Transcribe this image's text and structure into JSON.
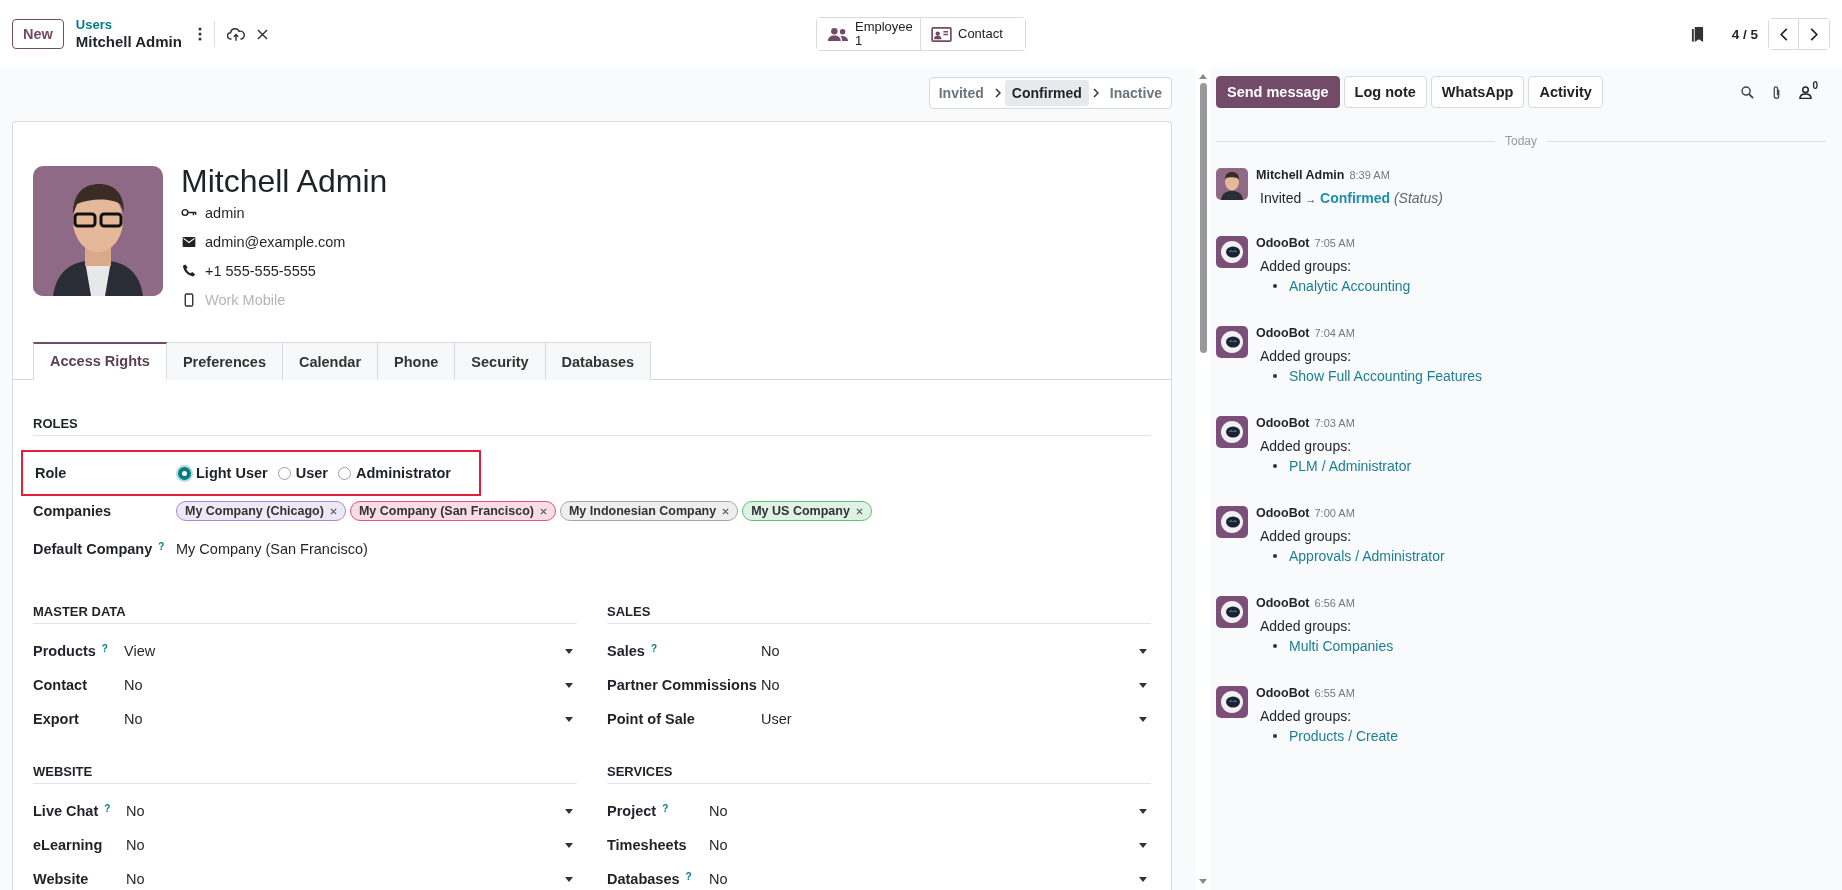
{
  "top_bar": {
    "new_button": "New",
    "breadcrumb": "Users",
    "record": "Mitchell Admin",
    "smart_buttons": [
      {
        "kind": "employee",
        "label": "Employee",
        "count": "1"
      },
      {
        "kind": "contact",
        "label": "Contact"
      }
    ],
    "pager": "4 / 5"
  },
  "statusbar": [
    {
      "label": "Invited",
      "selected": false
    },
    {
      "label": "Confirmed",
      "selected": true
    },
    {
      "label": "Inactive",
      "selected": false
    }
  ],
  "user": {
    "name": "Mitchell Admin",
    "login": "admin",
    "email": "admin@example.com",
    "phone": "+1 555-555-5555",
    "mobile_placeholder": "Work Mobile"
  },
  "tabs": [
    {
      "label": "Access Rights",
      "selected": true
    },
    {
      "label": "Preferences",
      "selected": false
    },
    {
      "label": "Calendar",
      "selected": false
    },
    {
      "label": "Phone",
      "selected": false
    },
    {
      "label": "Security",
      "selected": false
    },
    {
      "label": "Databases",
      "selected": false
    }
  ],
  "roles": {
    "title": "ROLES",
    "label": "Role",
    "highlighted": true,
    "options": [
      {
        "label": "Light User",
        "selected": true
      },
      {
        "label": "User",
        "selected": false
      },
      {
        "label": "Administrator",
        "selected": false
      }
    ],
    "companies_label": "Companies",
    "companies": [
      {
        "label": "My Company (Chicago)",
        "color": "#a58ad0"
      },
      {
        "label": "My Company (San Francisco)",
        "color": "#e0527f"
      },
      {
        "label": "My Indonesian Company",
        "color": "#a8a8a8"
      },
      {
        "label": "My US Company",
        "color": "#5fbf7b"
      }
    ],
    "default_company_label": "Default Company",
    "default_company_help": "?",
    "default_company": "My Company (San Francisco)"
  },
  "sections": [
    {
      "title": "MASTER DATA",
      "fields": [
        {
          "label": "Products",
          "help": "?",
          "value": "View"
        },
        {
          "label": "Contact",
          "value": "No"
        },
        {
          "label": "Export",
          "value": "No"
        }
      ]
    },
    {
      "title": "SALES",
      "fields": [
        {
          "label": "Sales",
          "help": "?",
          "value": "No"
        },
        {
          "label": "Partner Commissions",
          "value": "No"
        },
        {
          "label": "Point of Sale",
          "value": "User"
        }
      ]
    },
    {
      "title": "WEBSITE",
      "fields": [
        {
          "label": "Live Chat",
          "help": "?",
          "value": "No"
        },
        {
          "label": "eLearning",
          "value": "No"
        },
        {
          "label": "Website",
          "value": "No"
        }
      ]
    },
    {
      "title": "SERVICES",
      "fields": [
        {
          "label": "Project",
          "help": "?",
          "value": "No"
        },
        {
          "label": "Timesheets",
          "value": "No"
        },
        {
          "label": "Databases",
          "help": "?",
          "value": "No"
        }
      ]
    }
  ],
  "chatter": {
    "buttons": [
      {
        "label": "Send message",
        "selected": true
      },
      {
        "label": "Log note",
        "selected": false
      },
      {
        "label": "WhatsApp",
        "selected": false
      },
      {
        "label": "Activity",
        "selected": false
      }
    ],
    "followers": "0",
    "date": "Today",
    "messages": [
      {
        "kind": "tracking",
        "author": "Mitchell Admin",
        "time": "8:39 AM",
        "old": "Invited",
        "arrow": "→",
        "new": "Confirmed",
        "field": "(Status)"
      },
      {
        "kind": "groups",
        "author": "OdooBot",
        "time": "7:05 AM",
        "intro": "Added groups:",
        "groups": [
          "Analytic Accounting"
        ]
      },
      {
        "kind": "groups",
        "author": "OdooBot",
        "time": "7:04 AM",
        "intro": "Added groups:",
        "groups": [
          "Show Full Accounting Features"
        ]
      },
      {
        "kind": "groups",
        "author": "OdooBot",
        "time": "7:03 AM",
        "intro": "Added groups:",
        "groups": [
          "PLM / Administrator"
        ]
      },
      {
        "kind": "groups",
        "author": "OdooBot",
        "time": "7:00 AM",
        "intro": "Added groups:",
        "groups": [
          "Approvals / Administrator"
        ]
      },
      {
        "kind": "groups",
        "author": "OdooBot",
        "time": "6:56 AM",
        "intro": "Added groups:",
        "groups": [
          "Multi Companies"
        ]
      },
      {
        "kind": "groups",
        "author": "OdooBot",
        "time": "6:55 AM",
        "intro": "Added groups:",
        "groups": [
          "Products / Create"
        ]
      }
    ]
  }
}
